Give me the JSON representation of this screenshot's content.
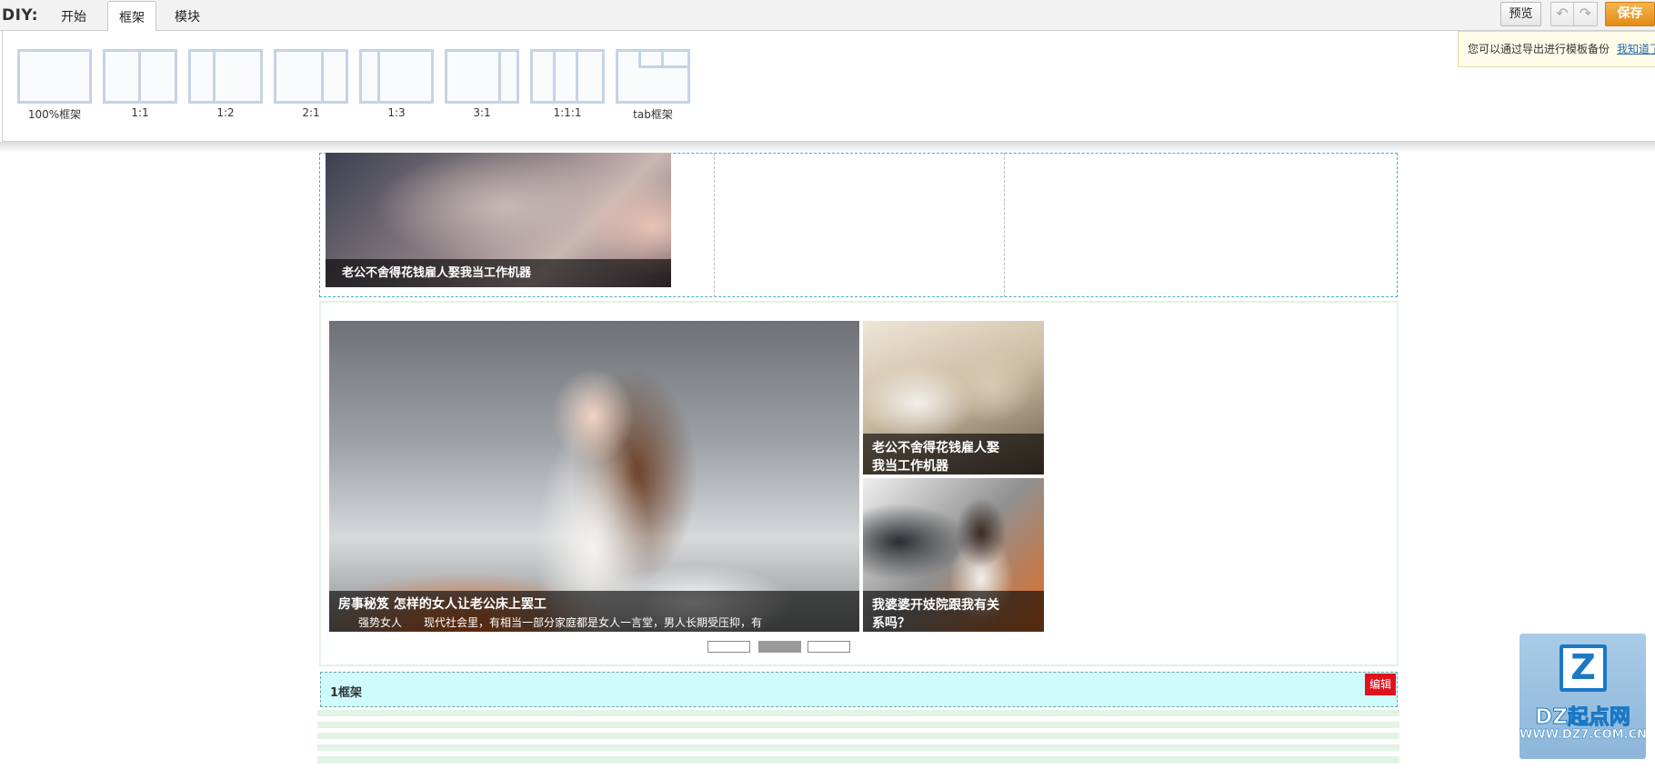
{
  "toolbar": {
    "diy_label": "DIY:",
    "tabs": [
      {
        "label": "开始"
      },
      {
        "label": "框架"
      },
      {
        "label": "模块"
      }
    ],
    "active_tab": "框架",
    "preview_label": "预览",
    "save_label": "保存"
  },
  "frames": [
    {
      "label": "100%框架"
    },
    {
      "label": "1:1"
    },
    {
      "label": "1:2"
    },
    {
      "label": "2:1"
    },
    {
      "label": "1:3"
    },
    {
      "label": "3:1"
    },
    {
      "label": "1:1:1"
    },
    {
      "label": "tab框架"
    }
  ],
  "notice": {
    "text": "您可以通过导出进行模板备份",
    "link": "我知道了"
  },
  "top_block": {
    "caption": "老公不舍得花钱雇人娶我当工作机器"
  },
  "slider": {
    "main_title": "房事秘笈 怎样的女人让老公床上罢工",
    "main_author": "强势女人",
    "main_desc": "现代社会里，有相当一部分家庭都是女人一言堂，男人长期受压抑，有",
    "side_items": [
      {
        "caption_line1": "老公不舍得花钱雇人娶",
        "caption_line2": "我当工作机器"
      },
      {
        "caption_line1": "我婆婆开妓院跟我有关",
        "caption_line2": "系吗？"
      }
    ],
    "pages": 3,
    "active_page": 2
  },
  "frame_block": {
    "name": "1框架",
    "edit_label": "编辑"
  },
  "watermark": {
    "icon_glyph": "Z",
    "name": "DZ起点网",
    "url": "WWW.DZ7.COM.CN"
  }
}
